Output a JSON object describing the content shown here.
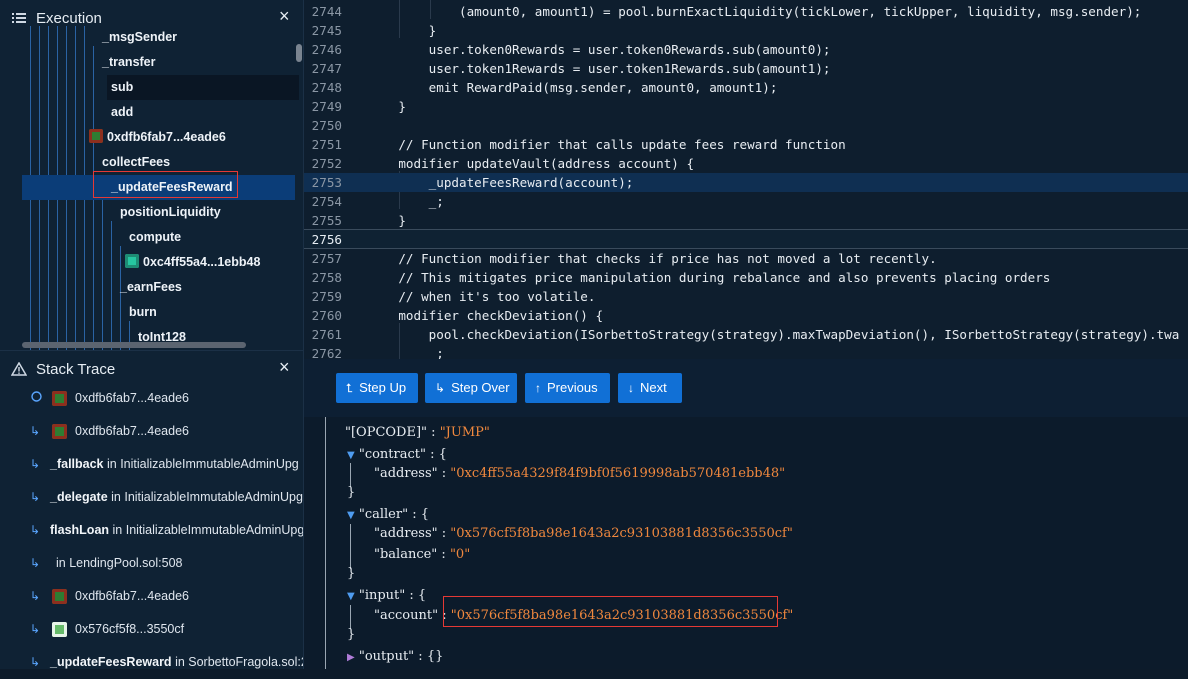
{
  "execution": {
    "title": "Execution",
    "nodes": [
      {
        "label": "_msgSender"
      },
      {
        "label": "_transfer"
      },
      {
        "label": "sub"
      },
      {
        "label": "add"
      },
      {
        "label": "0xdfb6fab7...4eade6"
      },
      {
        "label": "collectFees"
      },
      {
        "label": "_updateFeesReward"
      },
      {
        "label": "positionLiquidity"
      },
      {
        "label": "compute"
      },
      {
        "label": "0xc4ff55a4...1ebb48"
      },
      {
        "label": "_earnFees"
      },
      {
        "label": "burn"
      },
      {
        "label": "toInt128"
      }
    ]
  },
  "stack_trace": {
    "title": "Stack Trace",
    "rows": [
      {
        "name": "",
        "addr": "0xdfb6fab7...4eade6",
        "loc": ""
      },
      {
        "name": "",
        "addr": "0xdfb6fab7...4eade6",
        "loc": ""
      },
      {
        "name": "_fallback",
        "addr": "",
        "loc": "in InitializableImmutableAdminUpg"
      },
      {
        "name": "_delegate",
        "addr": "",
        "loc": "in InitializableImmutableAdminUpg"
      },
      {
        "name": "flashLoan",
        "addr": "",
        "loc": "in InitializableImmutableAdminUpg"
      },
      {
        "name": "",
        "addr": "",
        "loc": "in LendingPool.sol:508"
      },
      {
        "name": "",
        "addr": "0xdfb6fab7...4eade6",
        "loc": ""
      },
      {
        "name": "",
        "addr": "0x576cf5f8...3550cf",
        "loc": ""
      },
      {
        "name": "_updateFeesReward",
        "addr": "",
        "loc": "in SorbettoFragola.sol:2"
      }
    ]
  },
  "code": {
    "lines": [
      {
        "n": "2744",
        "t": "            (amount0, amount1) = pool.burnExactLiquidity(tickLower, tickUpper, liquidity, msg.sender);"
      },
      {
        "n": "2745",
        "t": "        }"
      },
      {
        "n": "2746",
        "t": "        user.token0Rewards = user.token0Rewards.sub(amount0);"
      },
      {
        "n": "2747",
        "t": "        user.token1Rewards = user.token1Rewards.sub(amount1);"
      },
      {
        "n": "2748",
        "t": "        emit RewardPaid(msg.sender, amount0, amount1);"
      },
      {
        "n": "2749",
        "t": "    }"
      },
      {
        "n": "2750",
        "t": ""
      },
      {
        "n": "2751",
        "t": "    // Function modifier that calls update fees reward function"
      },
      {
        "n": "2752",
        "t": "    modifier updateVault(address account) {"
      },
      {
        "n": "2753",
        "t": "        _updateFeesReward(account);"
      },
      {
        "n": "2754",
        "t": "        _;"
      },
      {
        "n": "2755",
        "t": "    }"
      },
      {
        "n": "2756",
        "t": ""
      },
      {
        "n": "2757",
        "t": "    // Function modifier that checks if price has not moved a lot recently."
      },
      {
        "n": "2758",
        "t": "    // This mitigates price manipulation during rebalance and also prevents placing orders"
      },
      {
        "n": "2759",
        "t": "    // when it's too volatile."
      },
      {
        "n": "2760",
        "t": "    modifier checkDeviation() {"
      },
      {
        "n": "2761",
        "t": "        pool.checkDeviation(ISorbettoStrategy(strategy).maxTwapDeviation(), ISorbettoStrategy(strategy).twa"
      },
      {
        "n": "2762",
        "t": "         ;"
      }
    ]
  },
  "toolbar": {
    "step_up": "Step Up",
    "step_over": "Step Over",
    "previous": "Previous",
    "next": "Next"
  },
  "state": {
    "opcode_key": "\"[OPCODE]\"",
    "opcode_val": "\"JUMP\"",
    "contract_key": "\"contract\"",
    "contract_address_key": "\"address\"",
    "contract_address_val": "\"0xc4ff55a4329f84f9bf0f5619998ab570481ebb48\"",
    "caller_key": "\"caller\"",
    "caller_address_key": "\"address\"",
    "caller_address_val": "\"0x576cf5f8ba98e1643a2c93103881d8356c3550cf\"",
    "caller_balance_key": "\"balance\"",
    "caller_balance_val": "\"0\"",
    "input_key": "\"input\"",
    "input_account_key": "\"account\"",
    "input_account_val": "\"0x576cf5f8ba98e1643a2c93103881d8356c3550cf\"",
    "output_key": "\"output\"",
    "output_val": "{}"
  },
  "colors": {
    "accent": "#1170d6",
    "selected_row": "#0b3d78",
    "highlight_box": "#e53935",
    "string": "#f0883e",
    "comment": "#5b8fd9"
  }
}
